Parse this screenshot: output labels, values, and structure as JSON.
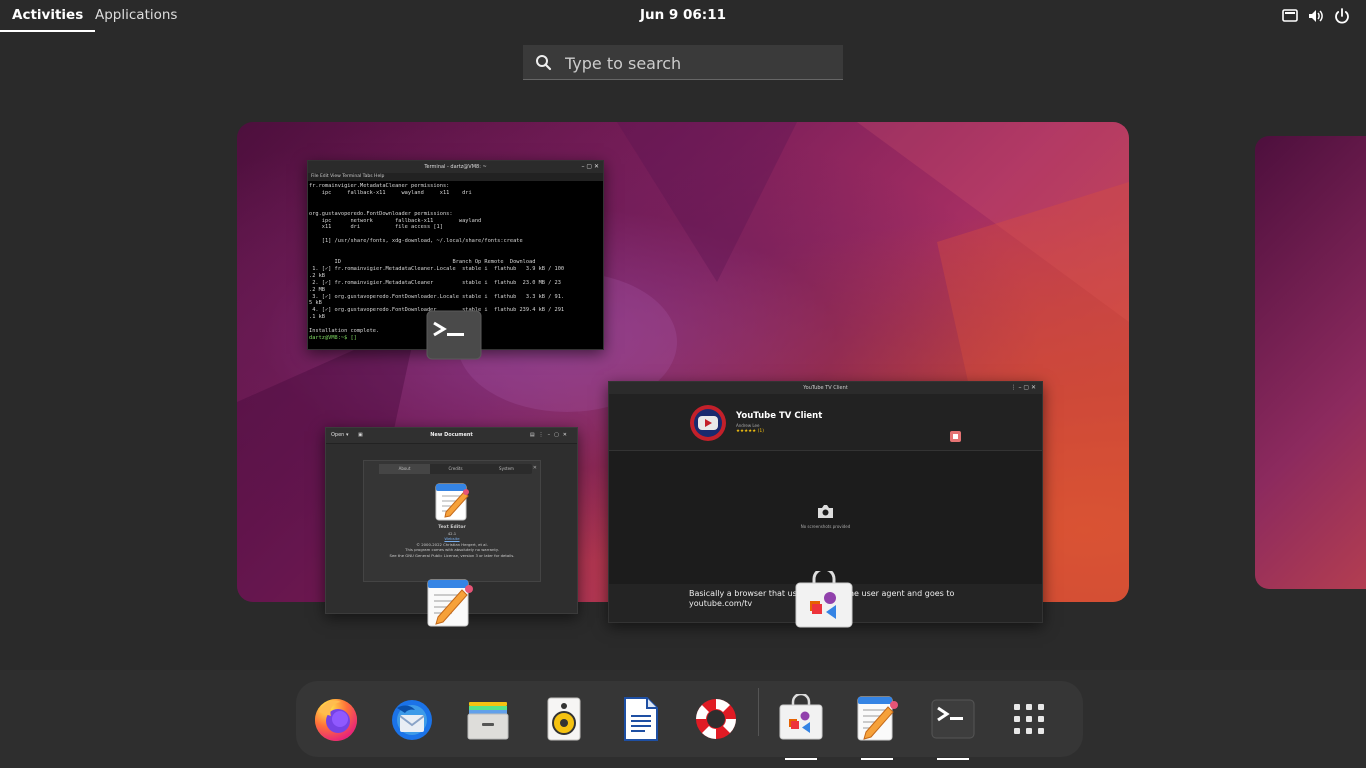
{
  "topbar": {
    "activities": "Activities",
    "applications": "Applications",
    "clock": "Jun 9  06:11",
    "tray_icons": [
      "screen-icon",
      "volume-icon",
      "power-icon"
    ]
  },
  "search": {
    "placeholder": "Type to search"
  },
  "windows": {
    "terminal": {
      "title": "Terminal - dartz@VM8: ~",
      "menu": "File   Edit   View   Terminal   Tabs   Help",
      "lines": [
        "fr.romainvigier.MetadataCleaner permissions:",
        "    ipc     fallback-x11     wayland     x11    dri",
        "",
        "",
        "org.gustavoperedo.FontDownloader permissions:",
        "    ipc      network       fallback-x11        wayland",
        "    x11      dri           file access [1]",
        "",
        "    [1] /usr/share/fonts, xdg-download, ~/.local/share/fonts:create",
        "",
        "",
        "        ID                                   Branch Op Remote  Download",
        " 1. [✓] fr.romainvigier.MetadataCleaner.Locale  stable i  flathub   3.9 kB / 100",
        ".2 kB",
        " 2. [✓] fr.romainvigier.MetadataCleaner         stable i  flathub  23.0 MB / 23",
        ".2 MB",
        " 3. [✓] org.gustavoperedo.FontDownloader.Locale stable i  flathub   3.3 kB / 91.",
        "5 kB",
        " 4. [✓] org.gustavoperedo.FontDownloader        stable i  flathub 239.4 kB / 291",
        ".1 kB",
        "",
        "Installation complete."
      ],
      "prompt": "dartz@VM8:~$ []"
    },
    "text_editor": {
      "open_label": "Open ▾",
      "title": "New Document",
      "about_tabs": [
        "About",
        "Credits",
        "System"
      ],
      "app_name": "Text Editor",
      "version": "42.1",
      "website": "Website",
      "copyright": "© 2000-2022 Christian Hergert, et al.",
      "warranty": "This program comes with absolutely no warranty.",
      "license": "See the GNU General Public License, version 3 or later for details."
    },
    "youtube": {
      "title": "YouTube TV Client",
      "app_name": "YouTube TV Client",
      "subtitle": "Andrew Lee",
      "rating": "★★★★★ (1)",
      "screenshot_note": "No screenshots provided",
      "description": "Basically a browser that uses Safari as the user agent and goes to youtube.com/tv"
    }
  },
  "dash": {
    "items": [
      {
        "name": "firefox",
        "label": "Firefox",
        "running": false
      },
      {
        "name": "thunderbird",
        "label": "Thunderbird",
        "running": false
      },
      {
        "name": "files",
        "label": "Files",
        "running": false
      },
      {
        "name": "rhythmbox",
        "label": "Rhythmbox",
        "running": false
      },
      {
        "name": "writer",
        "label": "LibreOffice Writer",
        "running": false
      },
      {
        "name": "help",
        "label": "Help",
        "running": false
      },
      {
        "name": "software",
        "label": "Software",
        "running": true
      },
      {
        "name": "text-editor",
        "label": "Text Editor",
        "running": true
      },
      {
        "name": "terminal",
        "label": "Terminal",
        "running": true
      },
      {
        "name": "show-apps",
        "label": "Show Applications",
        "running": false
      }
    ]
  },
  "colors": {
    "panel": "#2a2a2a",
    "accent_orange": "#e95420",
    "wallpaper_purple": "#7a1e5a"
  }
}
